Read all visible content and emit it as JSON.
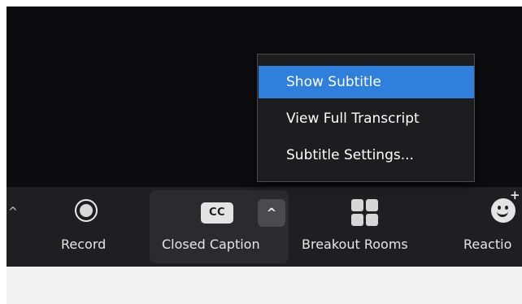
{
  "toolbar": {
    "record_label": "Record",
    "closed_caption_label": "Closed Caption",
    "cc_icon_text": "CC",
    "breakout_rooms_label": "Breakout Rooms",
    "reactions_label": "Reactio",
    "left_caret": "^",
    "cc_caret": "^",
    "reactions_plus": "+"
  },
  "menu": {
    "items": [
      {
        "label": "Show Subtitle",
        "highlighted": true
      },
      {
        "label": "View Full Transcript",
        "highlighted": false
      },
      {
        "label": "Subtitle Settings...",
        "highlighted": false
      }
    ]
  },
  "icons": {
    "record": "record-circle-icon",
    "cc": "closed-caption-icon",
    "breakout": "grid-icon",
    "reactions": "smiley-icon"
  },
  "colors": {
    "video_bg": "#0c0c0f",
    "toolbar_bg": "#1f1f22",
    "menu_bg": "#1d1d20",
    "menu_highlight": "#2f7fdd",
    "text": "#e6e6e6"
  }
}
